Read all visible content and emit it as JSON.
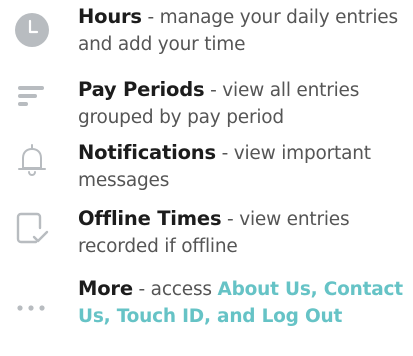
{
  "items": [
    {
      "icon": "clock-icon",
      "title": "Hours",
      "desc": " - manage your daily entries and add your time"
    },
    {
      "icon": "filter-lines-icon",
      "title": "Pay Periods",
      "desc": " - view all entries grouped by pay period"
    },
    {
      "icon": "bell-icon",
      "title": "Notifications",
      "desc": " - view important messages"
    },
    {
      "icon": "offline-check-icon",
      "title": "Offline Times",
      "desc": " - view entries recorded if offline"
    },
    {
      "icon": "more-dots-icon",
      "title": "More",
      "desc": " - access ",
      "links": "About Us, Contact Us, Touch ID, and Log Out"
    }
  ],
  "colors": {
    "icon_gray": "#b8bcc0",
    "title": "#1c1c1c",
    "text": "#555555",
    "link": "#66c3c6"
  }
}
